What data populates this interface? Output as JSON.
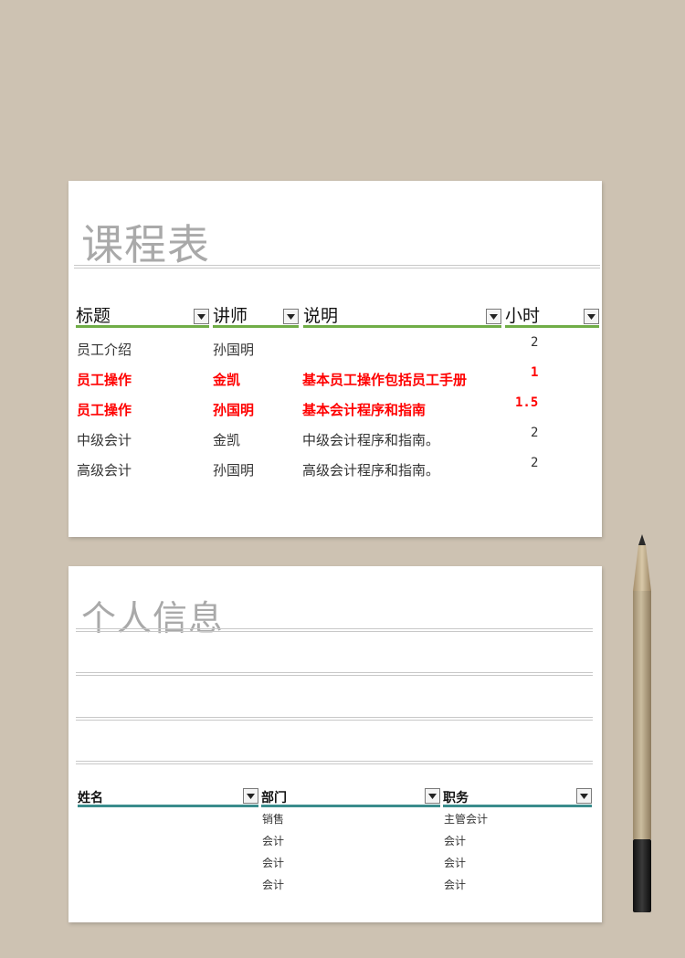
{
  "schedule": {
    "title": "课程表",
    "columns": [
      "标题",
      "讲师",
      "说明",
      "小时"
    ],
    "rows": [
      {
        "title": "员工介绍",
        "teacher": "孙国明",
        "desc": "",
        "hours": "2",
        "highlight": false
      },
      {
        "title": "员工操作",
        "teacher": "金凯",
        "desc": "基本员工操作包括员工手册",
        "hours": "1",
        "highlight": true
      },
      {
        "title": "员工操作",
        "teacher": "孙国明",
        "desc": "基本会计程序和指南",
        "hours": "1.5",
        "highlight": true
      },
      {
        "title": "中级会计",
        "teacher": "金凯",
        "desc": "中级会计程序和指南。",
        "hours": "2",
        "highlight": false
      },
      {
        "title": "高级会计",
        "teacher": "孙国明",
        "desc": "高级会计程序和指南。",
        "hours": "2",
        "highlight": false
      }
    ],
    "accent_color": "#70ad47",
    "highlight_color": "#ff0000"
  },
  "personal": {
    "title": "个人信息",
    "columns": [
      "姓名",
      "部门",
      "职务"
    ],
    "rows": [
      {
        "name": "",
        "dept": "销售",
        "role": "主管会计"
      },
      {
        "name": "",
        "dept": "会计",
        "role": "会计"
      },
      {
        "name": "",
        "dept": "会计",
        "role": "会计"
      },
      {
        "name": "",
        "dept": "会计",
        "role": "会计"
      }
    ],
    "accent_color": "#3a8c8c"
  },
  "icons": {
    "filter": "dropdown-arrow-icon",
    "decor": "pencil-icon"
  }
}
